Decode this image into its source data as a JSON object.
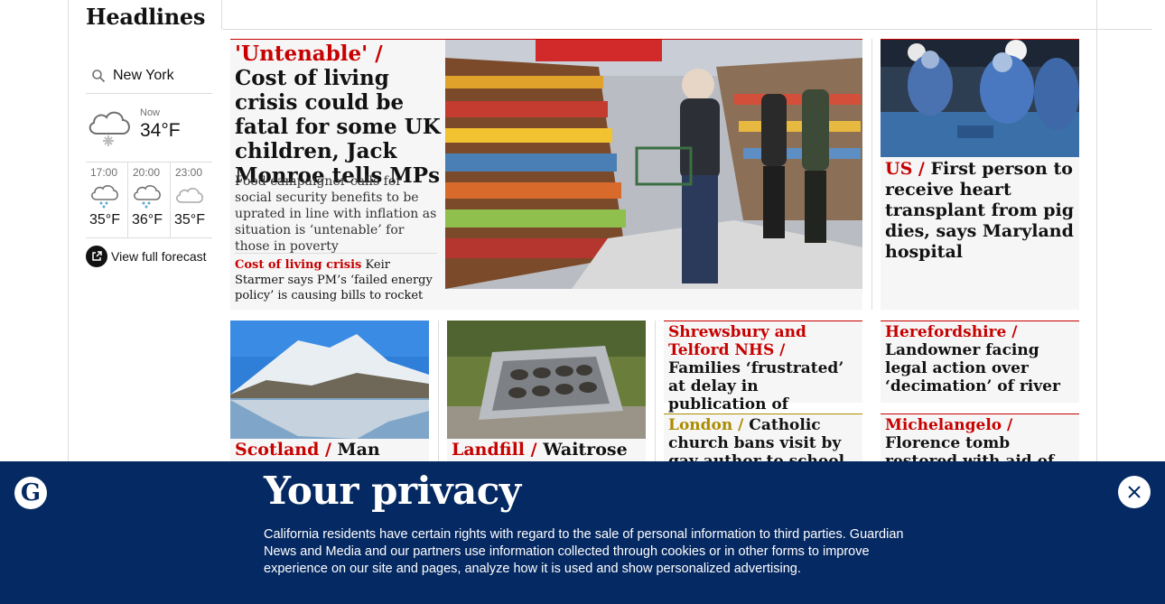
{
  "section": {
    "title": "Headlines"
  },
  "weather": {
    "location": "New York",
    "now_label": "Now",
    "now_temp": "34°F",
    "now_icon": "cloud-snow-icon",
    "hours": [
      {
        "time": "17:00",
        "temp": "35°F",
        "icon": "cloud-rain-icon"
      },
      {
        "time": "20:00",
        "temp": "36°F",
        "icon": "cloud-rain-icon"
      },
      {
        "time": "23:00",
        "temp": "35°F",
        "icon": "cloud-icon"
      }
    ],
    "forecast_link": "View full forecast"
  },
  "lead": {
    "kicker": "'Untenable' /",
    "headline": " Cost of living crisis could be fatal for some UK children, Jack Monroe tells MPs",
    "standfirst": "Food campaigner calls for social security benefits to be uprated in line with inflation as situation is ‘untenable’ for those in poverty",
    "sublink_kicker": "Cost of living crisis",
    "sublink_text": " Keir Starmer says PM’s ‘failed energy policy’ is causing bills to rocket"
  },
  "side": {
    "kicker": "US /",
    "headline": " First person to receive heart transplant from pig dies, says Maryland hospital"
  },
  "cards": [
    {
      "kicker": "Scotland /",
      "headline": " Man dies"
    },
    {
      "kicker": "Landfill /",
      "headline": " Waitrose and"
    }
  ],
  "text_cards": [
    {
      "kicker": "Shrewsbury and Telford NHS /",
      "headline": " Families ‘frustrated’ at delay in publication of maternity scandal report"
    },
    {
      "kicker": "Herefordshire /",
      "headline": " Landowner facing legal action over ‘decimation’ of river"
    },
    {
      "kicker": "London /",
      "headline": " Catholic church bans visit by gay author to school"
    },
    {
      "kicker": "Michelangelo /",
      "headline": " Florence tomb restored with aid of bacteria"
    }
  ],
  "privacy": {
    "title": "Your privacy",
    "text": "California residents have certain rights with regard to the sale of personal information to third parties. Guardian News and Media and our partners use information collected through cookies or in other forms to improve experience on our site and pages, analyze how it is used and show personalized advertising.",
    "logo_letter": "G"
  },
  "colors": {
    "news_red": "#c70000",
    "brand_blue": "#052962",
    "lifestyle_gold": "#ab8c00",
    "card_bg": "#f6f6f6"
  }
}
